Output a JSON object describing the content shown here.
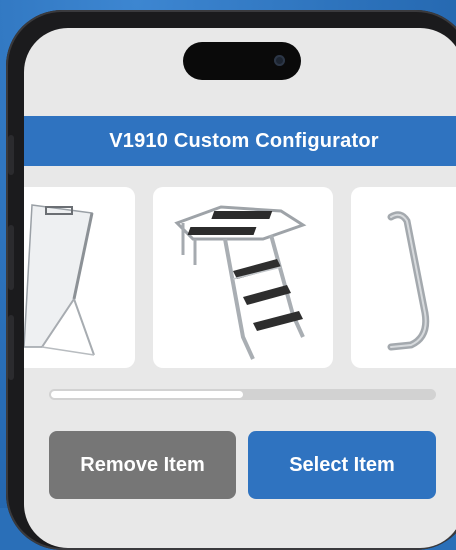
{
  "header": {
    "title": "V1910 Custom Configurator"
  },
  "carousel": {
    "items": [
      {
        "name": "side-panel-icon"
      },
      {
        "name": "ladder-icon"
      },
      {
        "name": "grab-rail-icon"
      }
    ],
    "scroll_progress": 0.5
  },
  "actions": {
    "remove_label": "Remove Item",
    "select_label": "Select Item"
  },
  "colors": {
    "brand_blue": "#2f73c0",
    "remove_gray": "#767676",
    "screen_bg": "#e8e8e8"
  }
}
